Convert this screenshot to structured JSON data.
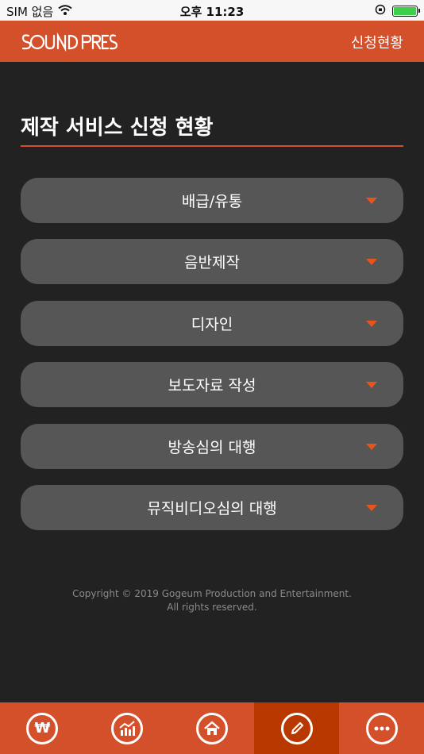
{
  "status_bar": {
    "carrier": "SIM 없음",
    "time": "오후 11:23"
  },
  "header": {
    "logo": "SOUND PRESS",
    "link": "신청현황"
  },
  "page": {
    "title": "제작 서비스 신청 현황"
  },
  "services": [
    {
      "label": "배급/유통"
    },
    {
      "label": "음반제작"
    },
    {
      "label": "디자인"
    },
    {
      "label": "보도자료 작성"
    },
    {
      "label": "방송심의 대행"
    },
    {
      "label": "뮤직비디오심의 대행"
    }
  ],
  "footer": {
    "copyright_line1": "Copyright © 2019 Gogeum Production and Entertainment.",
    "copyright_line2": "All rights reserved."
  },
  "tabs": [
    {
      "icon": "won-icon",
      "glyph": "₩"
    },
    {
      "icon": "chart-icon",
      "glyph": ""
    },
    {
      "icon": "home-icon",
      "glyph": ""
    },
    {
      "icon": "pencil-icon",
      "glyph": "",
      "active": true
    },
    {
      "icon": "more-icon",
      "glyph": "•••"
    }
  ],
  "colors": {
    "accent": "#d4502a",
    "accent_dark": "#b83800",
    "background": "#232222",
    "item_bg": "#565656",
    "chevron": "#e8541d"
  }
}
